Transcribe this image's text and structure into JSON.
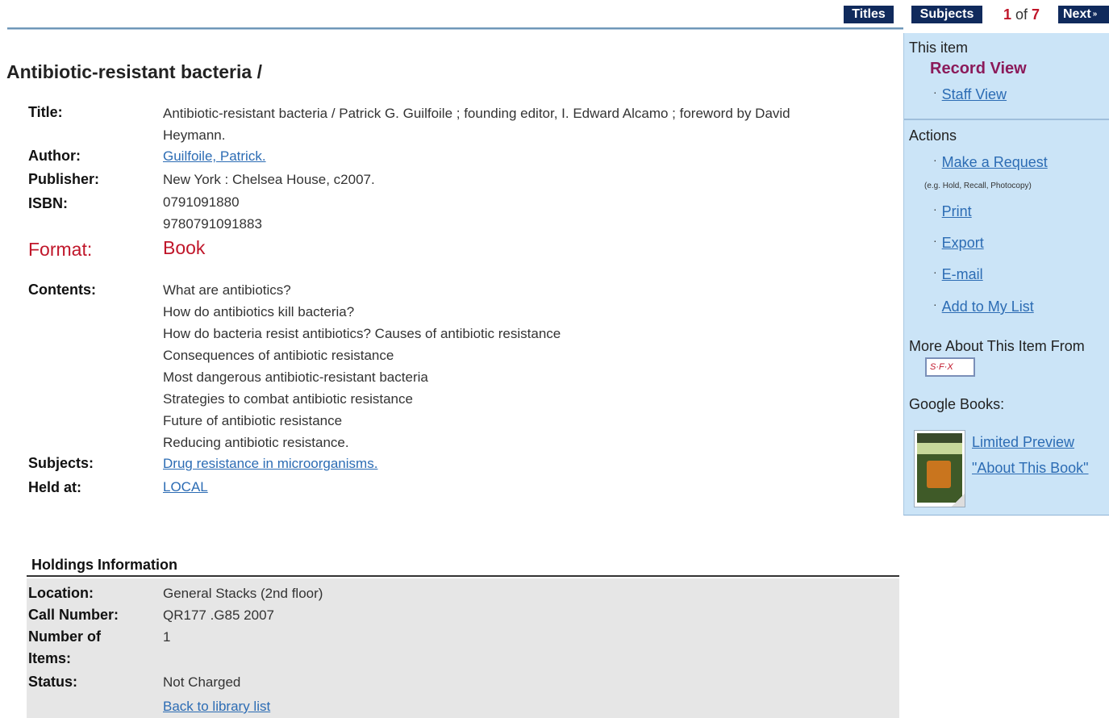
{
  "nav": {
    "titles": "Titles",
    "subjects": "Subjects",
    "current": "1",
    "of": "of",
    "total": "7",
    "next": "Next",
    "next_arrow": "»"
  },
  "record": {
    "heading": "Antibiotic-resistant bacteria /",
    "title_label": "Title:",
    "title_line1": "Antibiotic-resistant bacteria / Patrick G. Guilfoile ; founding editor, I. Edward Alcamo ; foreword by David",
    "title_line2": "Heymann.",
    "author_label": "Author:",
    "author": "Guilfoile, Patrick.",
    "publisher_label": "Publisher:",
    "publisher": "New York : Chelsea House, c2007.",
    "isbn_label": "ISBN:",
    "isbn1": "0791091880",
    "isbn2": "9780791091883",
    "format_label": "Format:",
    "format": "Book",
    "contents_label": "Contents:",
    "contents": [
      "What are antibiotics?",
      "How do antibiotics kill bacteria?",
      "How do bacteria resist antibiotics? Causes of antibiotic resistance",
      "Consequences of antibiotic resistance",
      "Most dangerous antibiotic-resistant bacteria",
      "Strategies to combat antibiotic resistance",
      "Future of antibiotic resistance",
      "Reducing antibiotic resistance."
    ],
    "subjects_label": "Subjects:",
    "subject": "Drug resistance in microorganisms.",
    "held_label": "Held at:",
    "held": "LOCAL"
  },
  "holdings": {
    "heading": "Holdings Information",
    "location_label": "Location:",
    "location": "General Stacks (2nd floor)",
    "call_label": "Call Number:",
    "call": "QR177 .G85 2007",
    "items_label1": "Number of",
    "items_label2": "Items:",
    "items": "1",
    "status_label": "Status:",
    "status": "Not Charged",
    "back_link": "Back to library list"
  },
  "sidebar": {
    "this_item": "This item",
    "record_view": "Record View",
    "staff_view": "Staff View",
    "actions": "Actions",
    "make_request": "Make a Request",
    "request_note": "(e.g. Hold, Recall, Photocopy)",
    "print": "Print",
    "export": "Export",
    "email": "E-mail",
    "add_list": "Add to My List",
    "more_about": "More About This Item From",
    "sfx": "S·F·X",
    "google_books": "Google Books:",
    "limited_preview": "Limited Preview",
    "about_book": "\"About This Book\""
  },
  "colors": {
    "nav_bg": "#102a5c",
    "accent_red": "#c0162a",
    "link": "#2c6cb4",
    "sidebar_bg": "#cbe4f7",
    "record_view": "#8b1a5a",
    "holdings_bg": "#e6e6e6"
  }
}
